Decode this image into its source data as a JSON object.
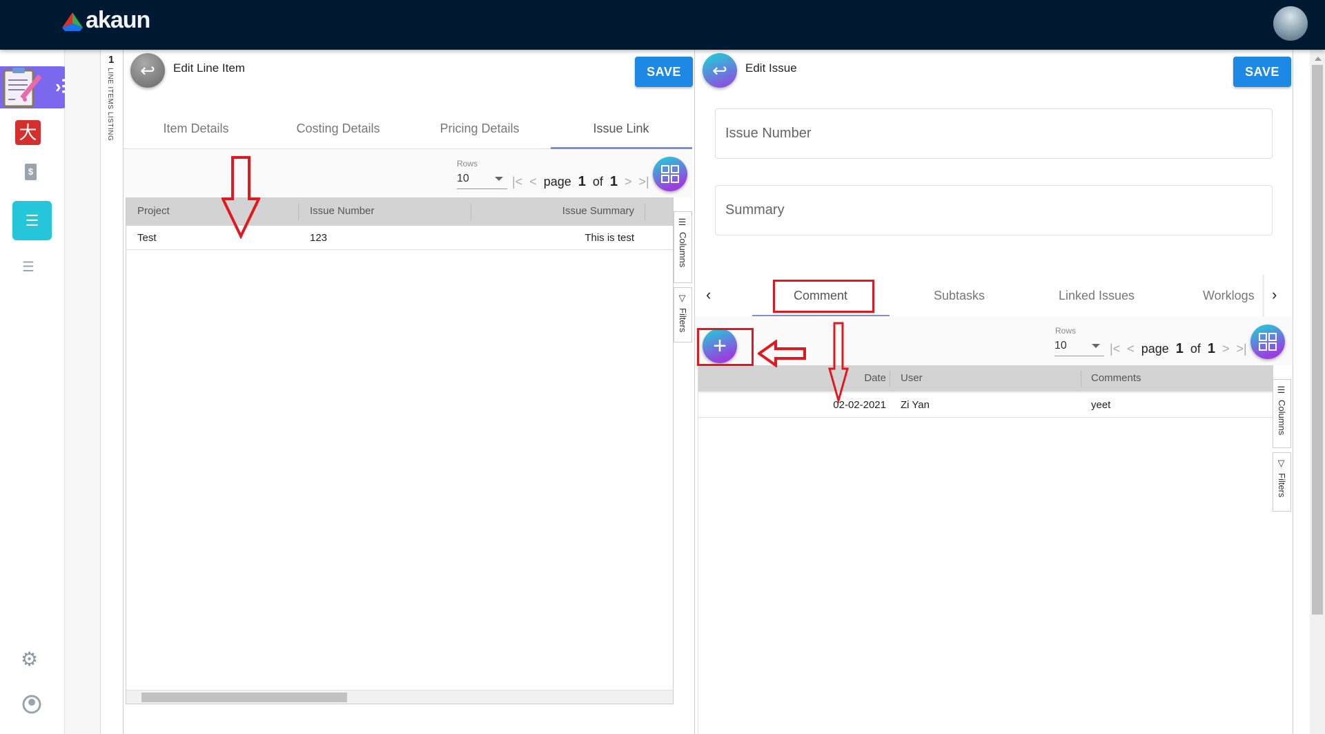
{
  "header": {
    "app_name": "akaun"
  },
  "colors": {
    "header_bg": "#001933",
    "save_button": "#1e88e5",
    "active_nav": "#26c6da",
    "annotation": "#e0191f"
  },
  "sidebar": {
    "items": [
      {
        "icon": "clipboard-pencil-icon"
      },
      {
        "icon": "red-app-icon"
      },
      {
        "icon": "invoice-dollar-icon"
      },
      {
        "icon": "list-icon",
        "active": true
      },
      {
        "icon": "list-icon"
      },
      {
        "icon": "gear-icon"
      },
      {
        "icon": "user-icon"
      }
    ]
  },
  "listing": {
    "count": "1",
    "label": "LINE ITEMS LISTING"
  },
  "left": {
    "title": "Edit Line Item",
    "save": "SAVE",
    "tabs": [
      "Item Details",
      "Costing Details",
      "Pricing Details",
      "Issue Link"
    ],
    "active_tab": "Issue Link",
    "rows_label": "Rows",
    "rows_value": "10",
    "page_word": "page",
    "page": "1",
    "of_word": "of",
    "total": "1",
    "columns": [
      "Project",
      "Issue Number",
      "Issue Summary"
    ],
    "rows": [
      [
        "Test",
        "123",
        "This is test"
      ]
    ],
    "side_columns": "Columns",
    "side_filters": "Filters"
  },
  "right": {
    "title": "Edit Issue",
    "save": "SAVE",
    "issue_number_placeholder": "Issue Number",
    "summary_placeholder": "Summary",
    "tabs": [
      "Comment",
      "Subtasks",
      "Linked Issues",
      "Worklogs"
    ],
    "active_tab": "Comment",
    "rows_label": "Rows",
    "rows_value": "10",
    "page_word": "page",
    "page": "1",
    "of_word": "of",
    "total": "1",
    "columns": [
      "Date",
      "User",
      "Comments"
    ],
    "rows": [
      [
        "02-02-2021",
        "Zi Yan",
        "yeet"
      ]
    ],
    "side_columns": "Columns",
    "side_filters": "Filters"
  }
}
